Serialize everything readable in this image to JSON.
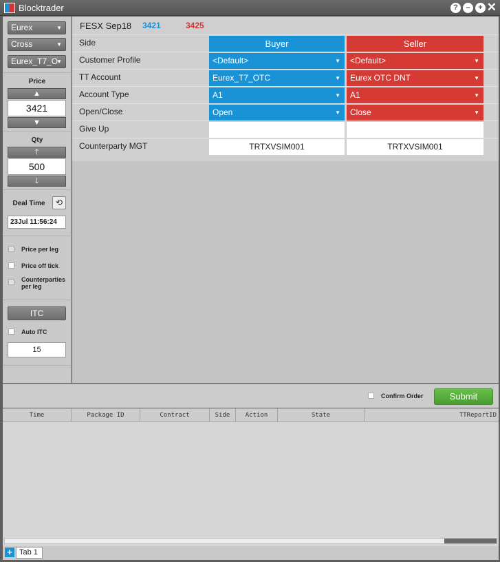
{
  "window": {
    "title": "Blocktrader",
    "help_glyph": "?",
    "minimize_glyph": "–",
    "maximize_glyph": "+",
    "close_glyph": "✕"
  },
  "sidebar": {
    "exchange_select": "Eurex",
    "type_select": "Cross",
    "gateway_select": "Eurex_T7_O",
    "price_label": "Price",
    "price_value": "3421",
    "qty_label": "Qty",
    "qty_value": "500",
    "deal_time_label": "Deal Time",
    "deal_time_value": "23Jul 11:56:24",
    "price_per_leg_label": "Price per leg",
    "price_off_tick_label": "Price off tick",
    "counterparties_per_leg_label": "Counterparties per leg",
    "itc_button": "ITC",
    "auto_itc_label": "Auto ITC",
    "itc_value": "15"
  },
  "header": {
    "contract": "FESX Sep18",
    "bid_price": "3421",
    "ask_price": "3425"
  },
  "form": {
    "rows": [
      {
        "label": "Side",
        "buyer": "Buyer",
        "seller": "Seller"
      },
      {
        "label": "Customer Profile",
        "buyer": "<Default>",
        "seller": "<Default>"
      },
      {
        "label": "TT Account",
        "buyer": "Eurex_T7_OTC",
        "seller": "Eurex OTC DNT"
      },
      {
        "label": "Account Type",
        "buyer": "A1",
        "seller": "A1"
      },
      {
        "label": "Open/Close",
        "buyer": "Open",
        "seller": "Close"
      },
      {
        "label": "Give Up",
        "buyer": "",
        "seller": ""
      },
      {
        "label": "Counterparty MGT",
        "buyer": "TRTXVSIM001",
        "seller": "TRTXVSIM001"
      }
    ]
  },
  "bottom_bar": {
    "confirm_order_label": "Confirm Order",
    "submit_label": "Submit"
  },
  "grid": {
    "columns": [
      "Time",
      "Package ID",
      "Contract",
      "Side",
      "Action",
      "State",
      "TTReportID"
    ],
    "rows": []
  },
  "tabs": {
    "add_glyph": "+",
    "items": [
      {
        "label": "Tab 1"
      }
    ]
  },
  "colors": {
    "buyer": "#1a93d6",
    "seller": "#d53a35",
    "submit": "#5aad3e"
  }
}
